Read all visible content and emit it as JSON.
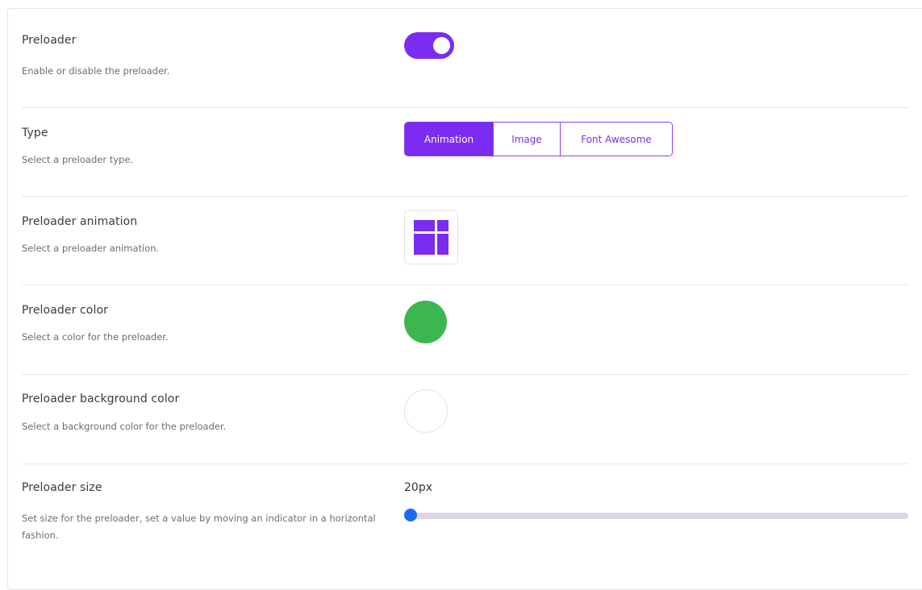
{
  "settings": {
    "preloader": {
      "label": "Preloader",
      "description": "Enable or disable the preloader.",
      "enabled": true
    },
    "type": {
      "label": "Type",
      "description": "Select a preloader type.",
      "options": [
        "Animation",
        "Image",
        "Font Awesome"
      ],
      "selected": "Animation"
    },
    "animation": {
      "label": "Preloader animation",
      "description": "Select a preloader animation."
    },
    "color": {
      "label": "Preloader color",
      "description": "Select a color for the preloader.",
      "value": "#3cb64f"
    },
    "background": {
      "label": "Preloader background color",
      "description": "Select a background color for the preloader.",
      "value": "#ffffff"
    },
    "size": {
      "label": "Preloader size",
      "description": "Set size for the preloader, set a value by moving an indicator in a horizontal fashion.",
      "value_label": "20px",
      "fraction": 0.0
    }
  },
  "colors": {
    "accent": "#7b2cf0",
    "slider_thumb": "#1a6bf0"
  }
}
